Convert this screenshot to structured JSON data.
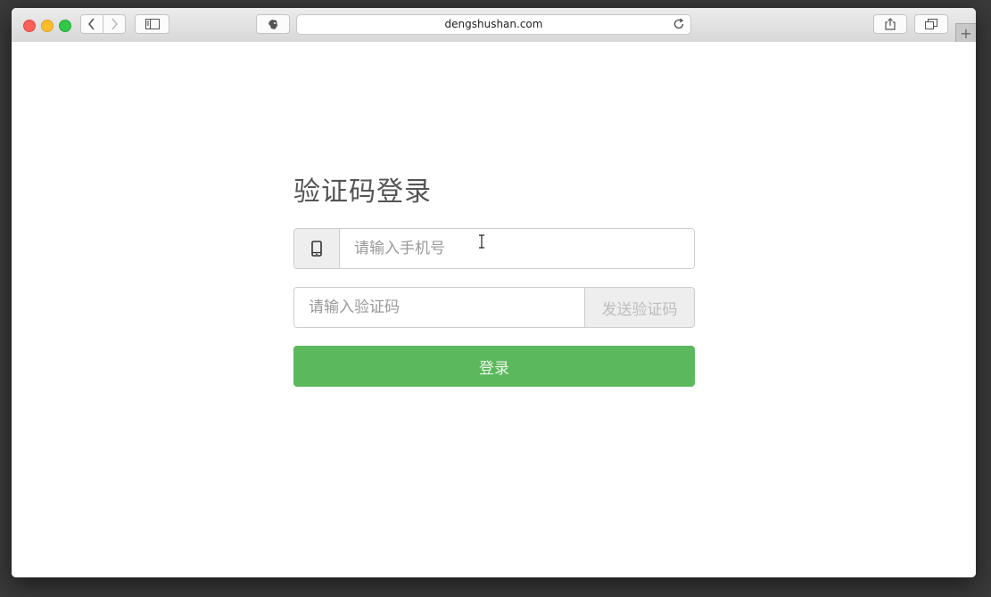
{
  "browser": {
    "url": "dengshushan.com",
    "newtab_symbol": "+"
  },
  "login": {
    "title": "验证码登录",
    "phone_placeholder": "请输入手机号",
    "code_placeholder": "请输入验证码",
    "send_code_label": "发送验证码",
    "submit_label": "登录"
  },
  "colors": {
    "primary_green": "#5cb85c",
    "addon_gray": "#eeeeee"
  }
}
